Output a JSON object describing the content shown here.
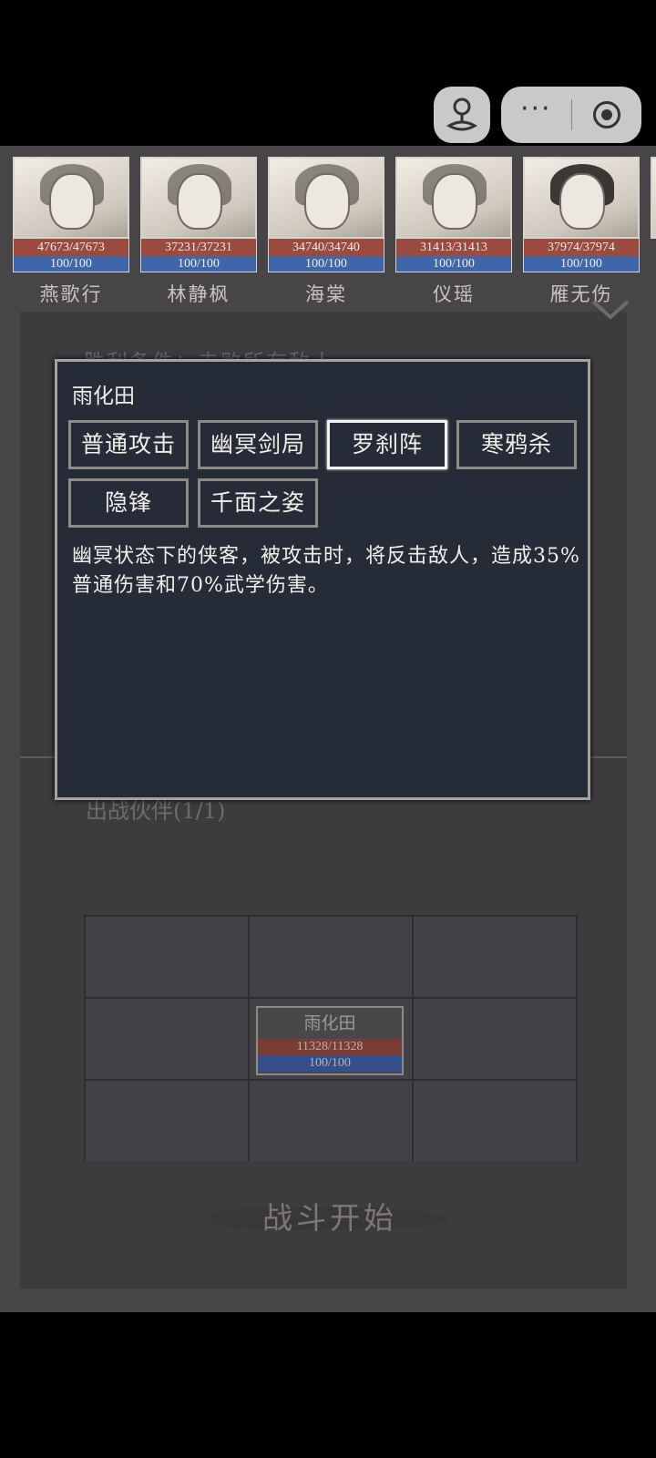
{
  "app": {
    "capsule": {
      "profile_icon": "joystick-icon",
      "more_icon": "more-dots-icon",
      "more_glyph": "···",
      "close_icon": "target-icon"
    }
  },
  "roster": [
    {
      "name": "燕歌行",
      "hp": "47673/47673",
      "mp": "100/100"
    },
    {
      "name": "林静枫",
      "hp": "37231/37231",
      "mp": "100/100"
    },
    {
      "name": "海棠",
      "hp": "34740/34740",
      "mp": "100/100"
    },
    {
      "name": "仪瑶",
      "hp": "31413/31413",
      "mp": "100/100"
    },
    {
      "name": "雁无伤",
      "hp": "37974/37974",
      "mp": "100/100"
    }
  ],
  "panel": {
    "victory_condition": "胜利条件：击败所有敌人",
    "sortie_label": "出战伙伴(1/1)",
    "expand_icon": "chevron-down-icon",
    "unit": {
      "name": "雨化田",
      "hp": "11328/11328",
      "mp": "100/100"
    },
    "start_button": "战斗开始"
  },
  "modal": {
    "title": "雨化田",
    "skills": [
      "普通攻击",
      "幽冥剑局",
      "罗刹阵",
      "寒鸦杀",
      "隐锋",
      "千面之姿"
    ],
    "selected_skill": "罗刹阵",
    "description": "幽冥状态下的侠客，被攻击时，将反击敌人，造成35%普通伤害和70%武学伤害。"
  },
  "colors": {
    "hp_bar": "#9a4a3e",
    "mp_bar": "#3f66a8",
    "modal_bg": "#252b37",
    "game_bg": "#484549"
  }
}
